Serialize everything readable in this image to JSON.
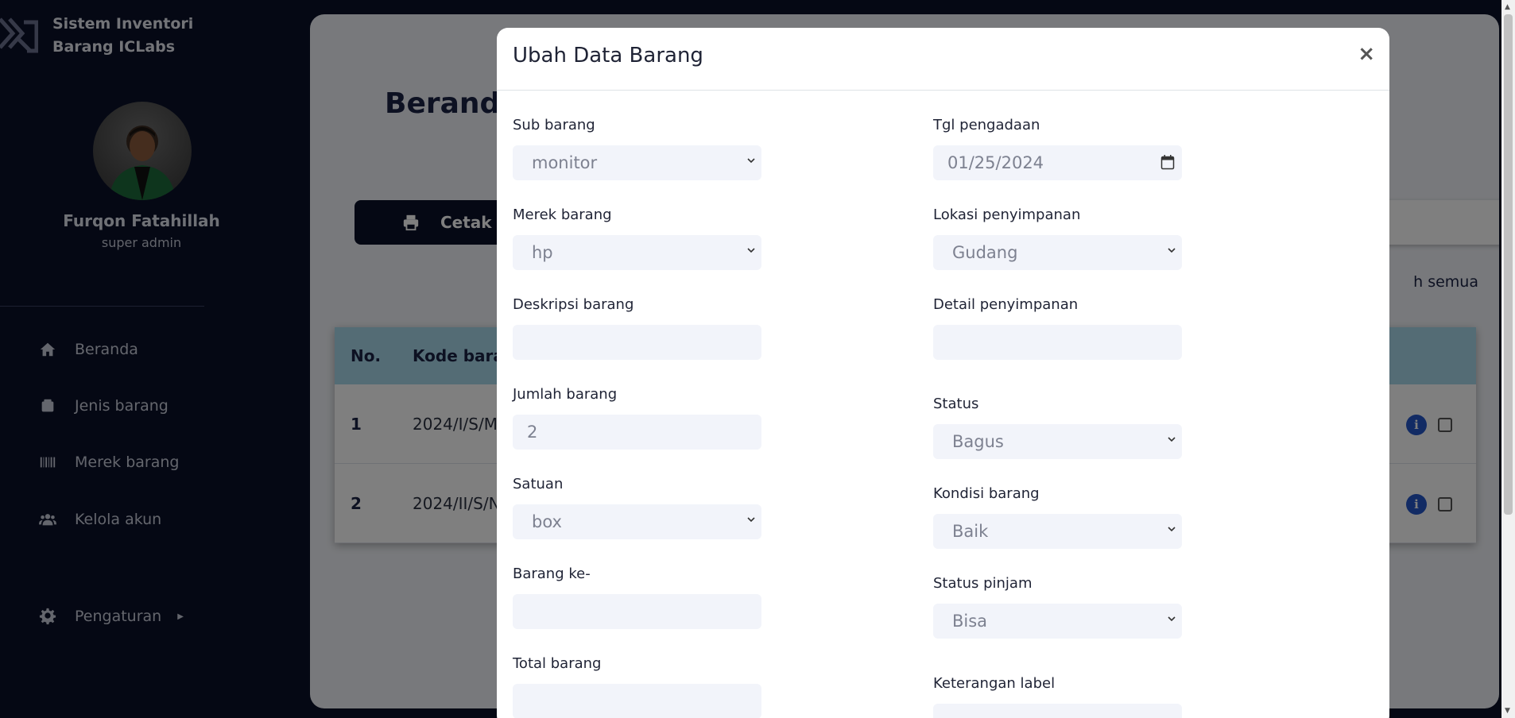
{
  "app": {
    "title": "Sistem Inventori Barang ICLabs"
  },
  "user": {
    "name": "Furqon Fatahillah",
    "role": "super admin"
  },
  "sidebar": {
    "items": [
      {
        "label": "Beranda",
        "icon": "home-icon"
      },
      {
        "label": "Jenis barang",
        "icon": "box-icon"
      },
      {
        "label": "Merek barang",
        "icon": "barcode-icon"
      },
      {
        "label": "Kelola akun",
        "icon": "users-icon"
      },
      {
        "label": "Pengaturan",
        "icon": "gear-icon"
      }
    ]
  },
  "main": {
    "page_title": "Beranda",
    "print_button": "Cetak",
    "select_all_link": "h semua",
    "table": {
      "headers": [
        "No.",
        "Kode bara"
      ],
      "rows": [
        {
          "no": "1",
          "kode": "2024/I/S/M"
        },
        {
          "no": "2",
          "kode": "2024/II/S/N"
        }
      ]
    }
  },
  "modal": {
    "title": "Ubah Data Barang",
    "close": "×",
    "fields": {
      "sub_barang": {
        "label": "Sub barang",
        "value": "monitor"
      },
      "merek_barang": {
        "label": "Merek barang",
        "value": "hp"
      },
      "deskripsi_barang": {
        "label": "Deskripsi barang",
        "value": ""
      },
      "jumlah_barang": {
        "label": "Jumlah barang",
        "value": "2"
      },
      "satuan": {
        "label": "Satuan",
        "value": "box"
      },
      "barang_ke": {
        "label": "Barang ke-",
        "value": ""
      },
      "total_barang": {
        "label": "Total barang",
        "value": ""
      },
      "tgl_pengadaan": {
        "label": "Tgl pengadaan",
        "value": "01/25/2024"
      },
      "lokasi_penyimpanan": {
        "label": "Lokasi penyimpanan",
        "value": "Gudang"
      },
      "detail_penyimpanan": {
        "label": "Detail penyimpanan",
        "value": ""
      },
      "status": {
        "label": "Status",
        "value": "Bagus"
      },
      "kondisi_barang": {
        "label": "Kondisi barang",
        "value": "Baik"
      },
      "status_pinjam": {
        "label": "Status pinjam",
        "value": "Bisa"
      },
      "keterangan_label": {
        "label": "Keterangan label",
        "value": ""
      }
    }
  },
  "colors": {
    "sidebar_bg": "#0b1129",
    "table_header": "#a9d9ea",
    "input_bg": "#f2f4fa",
    "info_icon": "#2456c8"
  }
}
